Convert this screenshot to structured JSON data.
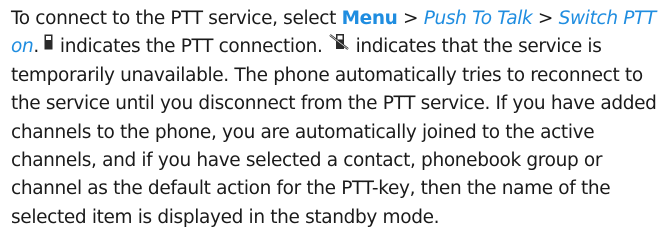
{
  "paragraph": {
    "l1_a": "To connect to the PTT service, select ",
    "menu": "Menu",
    "sep1": " > ",
    "push_to_talk": "Push To Talk",
    "sep2": " > ",
    "switch_ptt_a": "Switch PTT",
    "switch_ptt_b": "on",
    "l2_a": ". ",
    "connected_icon": "ptt-connected-icon",
    "l2_b": " indicates the PTT connection. ",
    "unavailable_icon": "ptt-unavailable-icon",
    "l2_c": " indicates that the service is",
    "l3": "temporarily unavailable. The phone automatically tries to reconnect to",
    "l4": "the service until you disconnect from the PTT service. If you have added",
    "l5": "channels to the phone, you are automatically joined to the active",
    "l6": "channels, and if you have selected a contact, phonebook group or",
    "l7": "channel as the default action for the PTT-key, then the name of the",
    "l8": "selected item is displayed in the standby mode."
  }
}
